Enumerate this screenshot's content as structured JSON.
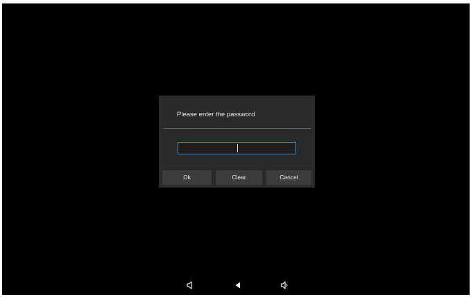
{
  "dialog": {
    "title": "Please enter the password",
    "password_value": "",
    "buttons": {
      "ok": "Ok",
      "clear": "Clear",
      "cancel": "Cancel"
    },
    "accent_color": "#4c8cc3"
  },
  "navigation_bar": {
    "icons": [
      "volume-down-icon",
      "back-icon",
      "volume-up-icon"
    ]
  }
}
